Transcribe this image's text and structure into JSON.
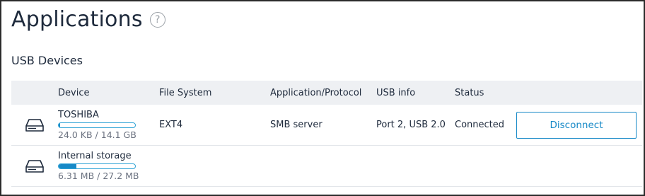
{
  "page": {
    "title": "Applications",
    "help_icon": "?"
  },
  "section": {
    "title": "USB Devices"
  },
  "table": {
    "headers": {
      "device": "Device",
      "file_system": "File System",
      "application": "Application/Protocol",
      "usb_info": "USB info",
      "status": "Status"
    },
    "rows": [
      {
        "icon": "hard-drive-icon",
        "name": "TOSHIBA",
        "usage": "24.0 KB / 14.1 GB",
        "usage_fraction": 0.0017,
        "file_system": "EXT4",
        "application": "SMB server",
        "usb_info": "Port 2, USB 2.0",
        "status": "Connected",
        "action": "Disconnect"
      },
      {
        "icon": "hard-drive-icon",
        "name": "Internal storage",
        "usage": "6.31 MB / 27.2 MB",
        "usage_fraction": 0.232,
        "file_system": "",
        "application": "",
        "usb_info": "",
        "status": "",
        "action": ""
      }
    ]
  },
  "colors": {
    "accent": "#1789c7",
    "bar_border": "#2fa3d6",
    "header_bg": "#eef0f3"
  }
}
